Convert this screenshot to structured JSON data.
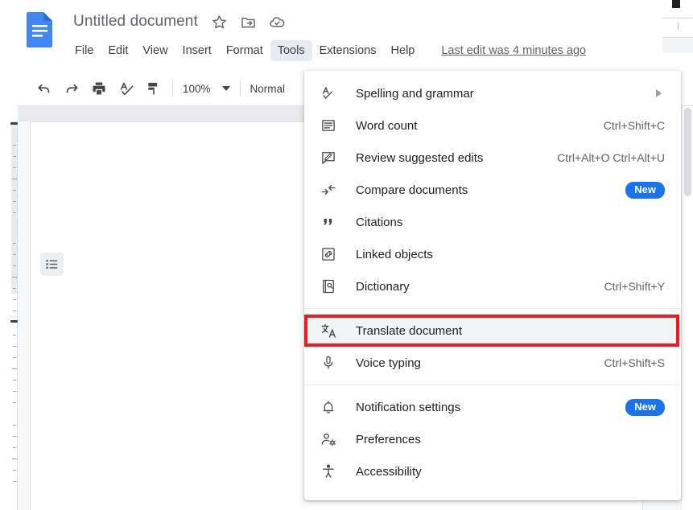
{
  "header": {
    "doc_icon": "google-docs-icon",
    "title": "Untitled document",
    "actions": [
      {
        "name": "star-icon",
        "label": "Star"
      },
      {
        "name": "move-to-folder-icon",
        "label": "Move"
      },
      {
        "name": "cloud-saved-icon",
        "label": "Saved to Drive"
      }
    ],
    "menus": [
      {
        "label": "File",
        "active": false
      },
      {
        "label": "Edit",
        "active": false
      },
      {
        "label": "View",
        "active": false
      },
      {
        "label": "Insert",
        "active": false
      },
      {
        "label": "Format",
        "active": false
      },
      {
        "label": "Tools",
        "active": true
      },
      {
        "label": "Extensions",
        "active": false
      },
      {
        "label": "Help",
        "active": false
      }
    ],
    "last_edit": "Last edit was 4 minutes ago"
  },
  "toolbar": {
    "icons": [
      {
        "name": "undo-icon",
        "label": "Undo"
      },
      {
        "name": "redo-icon",
        "label": "Redo"
      },
      {
        "name": "print-icon",
        "label": "Print"
      },
      {
        "name": "spelling-check-icon",
        "label": "Spelling and grammar check"
      },
      {
        "name": "paint-format-icon",
        "label": "Paint format"
      }
    ],
    "zoom": "100%",
    "style": "Normal"
  },
  "document": {
    "outline_icon": "document-outline-icon"
  },
  "menu": {
    "title": "Tools",
    "items": [
      {
        "icon": "spelling-grammar-icon",
        "label": "Spelling and grammar",
        "shortcut": "",
        "submenu": true,
        "badge": "",
        "separator_after": false,
        "highlighted": false
      },
      {
        "icon": "word-count-icon",
        "label": "Word count",
        "shortcut": "Ctrl+Shift+C",
        "submenu": false,
        "badge": "",
        "separator_after": false,
        "highlighted": false
      },
      {
        "icon": "review-suggested-edits-icon",
        "label": "Review suggested edits",
        "shortcut": "Ctrl+Alt+O Ctrl+Alt+U",
        "submenu": false,
        "badge": "",
        "separator_after": false,
        "highlighted": false
      },
      {
        "icon": "compare-documents-icon",
        "label": "Compare documents",
        "shortcut": "",
        "submenu": false,
        "badge": "New",
        "separator_after": false,
        "highlighted": false
      },
      {
        "icon": "citations-icon",
        "label": "Citations",
        "shortcut": "",
        "submenu": false,
        "badge": "",
        "separator_after": false,
        "highlighted": false
      },
      {
        "icon": "linked-objects-icon",
        "label": "Linked objects",
        "shortcut": "",
        "submenu": false,
        "badge": "",
        "separator_after": false,
        "highlighted": false
      },
      {
        "icon": "dictionary-icon",
        "label": "Dictionary",
        "shortcut": "Ctrl+Shift+Y",
        "submenu": false,
        "badge": "",
        "separator_after": true,
        "highlighted": false
      },
      {
        "icon": "translate-document-icon",
        "label": "Translate document",
        "shortcut": "",
        "submenu": false,
        "badge": "",
        "separator_after": false,
        "highlighted": true
      },
      {
        "icon": "voice-typing-icon",
        "label": "Voice typing",
        "shortcut": "Ctrl+Shift+S",
        "submenu": false,
        "badge": "",
        "separator_after": true,
        "highlighted": false
      },
      {
        "icon": "notification-settings-icon",
        "label": "Notification settings",
        "shortcut": "",
        "submenu": false,
        "badge": "New",
        "separator_after": false,
        "highlighted": false
      },
      {
        "icon": "preferences-icon",
        "label": "Preferences",
        "shortcut": "",
        "submenu": false,
        "badge": "",
        "separator_after": false,
        "highlighted": false
      },
      {
        "icon": "accessibility-icon",
        "label": "Accessibility",
        "shortcut": "",
        "submenu": false,
        "badge": "",
        "separator_after": false,
        "highlighted": false
      }
    ]
  },
  "colors": {
    "accent": "#1a73e8",
    "highlight_box": "#ea1c24",
    "menu_active_bg": "#e8eaf3",
    "item_highlight_bg": "#f1f3f4"
  }
}
